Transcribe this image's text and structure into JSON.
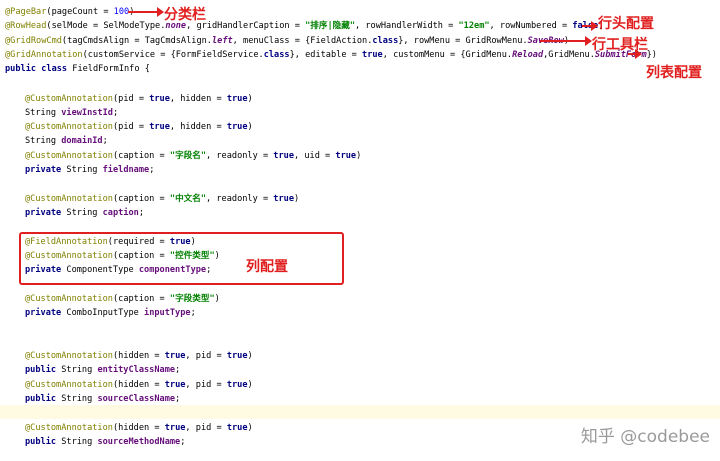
{
  "lines": [
    [
      {
        "c": "ann",
        "t": "@PageBar"
      },
      {
        "c": "txt",
        "t": "(pageCount = "
      },
      {
        "c": "num",
        "t": "100"
      },
      {
        "c": "txt",
        "t": ")"
      }
    ],
    [
      {
        "c": "ann",
        "t": "@RowHead"
      },
      {
        "c": "txt",
        "t": "(selMode = SelModeType."
      },
      {
        "c": "ital",
        "t": "none"
      },
      {
        "c": "txt",
        "t": ", gridHandlerCaption = "
      },
      {
        "c": "str",
        "t": "\"排序|隐藏\""
      },
      {
        "c": "txt",
        "t": ", rowHandlerWidth = "
      },
      {
        "c": "str",
        "t": "\"12em\""
      },
      {
        "c": "txt",
        "t": ", rowNumbered = "
      },
      {
        "c": "kw",
        "t": "false"
      },
      {
        "c": "txt",
        "t": ")"
      }
    ],
    [
      {
        "c": "ann",
        "t": "@GridRowCmd"
      },
      {
        "c": "txt",
        "t": "(tagCmdsAlign = TagCmdsAlign."
      },
      {
        "c": "ital",
        "t": "left"
      },
      {
        "c": "txt",
        "t": ", menuClass = {FieldAction."
      },
      {
        "c": "kw",
        "t": "class"
      },
      {
        "c": "txt",
        "t": "}, rowMenu = GridRowMenu."
      },
      {
        "c": "ital",
        "t": "SaveRow"
      },
      {
        "c": "txt",
        "t": ")"
      }
    ],
    [
      {
        "c": "ann",
        "t": "@GridAnnotation"
      },
      {
        "c": "txt",
        "t": "(customService = {FormFieldService."
      },
      {
        "c": "kw",
        "t": "class"
      },
      {
        "c": "txt",
        "t": "}, editable = "
      },
      {
        "c": "kw",
        "t": "true"
      },
      {
        "c": "txt",
        "t": ", customMenu = {GridMenu."
      },
      {
        "c": "ital",
        "t": "Reload"
      },
      {
        "c": "txt",
        "t": ",GridMenu."
      },
      {
        "c": "ital",
        "t": "SubmitForm"
      },
      {
        "c": "txt",
        "t": "})"
      }
    ],
    [
      {
        "c": "kw",
        "t": "public class "
      },
      {
        "c": "txt",
        "t": "FieldFormInfo {"
      }
    ],
    [
      {
        "c": "ann",
        "t": "@CustomAnnotation"
      },
      {
        "c": "txt",
        "t": "(pid = "
      },
      {
        "c": "kw",
        "t": "true"
      },
      {
        "c": "txt",
        "t": ", hidden = "
      },
      {
        "c": "kw",
        "t": "true"
      },
      {
        "c": "txt",
        "t": ")"
      }
    ],
    [
      {
        "c": "txt",
        "t": "String "
      },
      {
        "c": "fld",
        "t": "viewInstId"
      },
      {
        "c": "txt",
        "t": ";"
      }
    ],
    [
      {
        "c": "ann",
        "t": "@CustomAnnotation"
      },
      {
        "c": "txt",
        "t": "(pid = "
      },
      {
        "c": "kw",
        "t": "true"
      },
      {
        "c": "txt",
        "t": ", hidden = "
      },
      {
        "c": "kw",
        "t": "true"
      },
      {
        "c": "txt",
        "t": ")"
      }
    ],
    [
      {
        "c": "txt",
        "t": "String "
      },
      {
        "c": "fld",
        "t": "domainId"
      },
      {
        "c": "txt",
        "t": ";"
      }
    ],
    [
      {
        "c": "ann",
        "t": "@CustomAnnotation"
      },
      {
        "c": "txt",
        "t": "(caption = "
      },
      {
        "c": "str",
        "t": "\"字段名\""
      },
      {
        "c": "txt",
        "t": ", readonly = "
      },
      {
        "c": "kw",
        "t": "true"
      },
      {
        "c": "txt",
        "t": ", uid = "
      },
      {
        "c": "kw",
        "t": "true"
      },
      {
        "c": "txt",
        "t": ")"
      }
    ],
    [
      {
        "c": "kw",
        "t": "private "
      },
      {
        "c": "txt",
        "t": "String "
      },
      {
        "c": "fld",
        "t": "fieldname"
      },
      {
        "c": "txt",
        "t": ";"
      }
    ],
    [
      {
        "c": "ann",
        "t": "@CustomAnnotation"
      },
      {
        "c": "txt",
        "t": "(caption = "
      },
      {
        "c": "str",
        "t": "\"中文名\""
      },
      {
        "c": "txt",
        "t": ", readonly = "
      },
      {
        "c": "kw",
        "t": "true"
      },
      {
        "c": "txt",
        "t": ")"
      }
    ],
    [
      {
        "c": "kw",
        "t": "private "
      },
      {
        "c": "txt",
        "t": "String "
      },
      {
        "c": "fld",
        "t": "caption"
      },
      {
        "c": "txt",
        "t": ";"
      }
    ],
    [
      {
        "c": "ann",
        "t": "@FieldAnnotation"
      },
      {
        "c": "txt",
        "t": "(required = "
      },
      {
        "c": "kw",
        "t": "true"
      },
      {
        "c": "txt",
        "t": ")"
      }
    ],
    [
      {
        "c": "ann",
        "t": "@CustomAnnotation"
      },
      {
        "c": "txt",
        "t": "(caption = "
      },
      {
        "c": "str",
        "t": "\"控件类型\""
      },
      {
        "c": "txt",
        "t": ")"
      }
    ],
    [
      {
        "c": "kw",
        "t": "private "
      },
      {
        "c": "txt",
        "t": "ComponentType "
      },
      {
        "c": "fld",
        "t": "componentType"
      },
      {
        "c": "txt",
        "t": ";"
      }
    ],
    [
      {
        "c": "ann",
        "t": "@CustomAnnotation"
      },
      {
        "c": "txt",
        "t": "(caption = "
      },
      {
        "c": "str",
        "t": "\"字段类型\""
      },
      {
        "c": "txt",
        "t": ")"
      }
    ],
    [
      {
        "c": "kw",
        "t": "private "
      },
      {
        "c": "txt",
        "t": "ComboInputType "
      },
      {
        "c": "fld",
        "t": "inputType"
      },
      {
        "c": "txt",
        "t": ";"
      }
    ],
    [
      {
        "c": "ann",
        "t": "@CustomAnnotation"
      },
      {
        "c": "txt",
        "t": "(hidden = "
      },
      {
        "c": "kw",
        "t": "true"
      },
      {
        "c": "txt",
        "t": ", pid = "
      },
      {
        "c": "kw",
        "t": "true"
      },
      {
        "c": "txt",
        "t": ")"
      }
    ],
    [
      {
        "c": "kw",
        "t": "public "
      },
      {
        "c": "txt",
        "t": "String "
      },
      {
        "c": "fld",
        "t": "entityClassName"
      },
      {
        "c": "txt",
        "t": ";"
      }
    ],
    [
      {
        "c": "ann",
        "t": "@CustomAnnotation"
      },
      {
        "c": "txt",
        "t": "(hidden = "
      },
      {
        "c": "kw",
        "t": "true"
      },
      {
        "c": "txt",
        "t": ", pid = "
      },
      {
        "c": "kw",
        "t": "true"
      },
      {
        "c": "txt",
        "t": ")"
      }
    ],
    [
      {
        "c": "kw",
        "t": "public "
      },
      {
        "c": "txt",
        "t": "String "
      },
      {
        "c": "fld",
        "t": "sourceClassName"
      },
      {
        "c": "txt",
        "t": ";"
      }
    ],
    [
      {
        "c": "ann",
        "t": "@CustomAnnotation"
      },
      {
        "c": "txt",
        "t": "(hidden = "
      },
      {
        "c": "kw",
        "t": "true"
      },
      {
        "c": "txt",
        "t": ", pid = "
      },
      {
        "c": "kw",
        "t": "true"
      },
      {
        "c": "txt",
        "t": ")"
      }
    ],
    [
      {
        "c": "kw",
        "t": "public "
      },
      {
        "c": "txt",
        "t": "String "
      },
      {
        "c": "fld",
        "t": "sourceMethodName"
      },
      {
        "c": "txt",
        "t": ";"
      }
    ]
  ],
  "callouts": {
    "category_bar": "分类栏",
    "row_head": "行头配置",
    "row_toolbar": "行工具栏",
    "list_config": "列表配置",
    "column_config": "列配置"
  },
  "watermark": "知乎 @codebee",
  "colors": {
    "annotation": "#808000",
    "keyword": "#000080",
    "string": "#008000",
    "number": "#0000ff",
    "field": "#660e7a",
    "callout_red": "#e02020",
    "highlight_line": "#fffbe3"
  }
}
